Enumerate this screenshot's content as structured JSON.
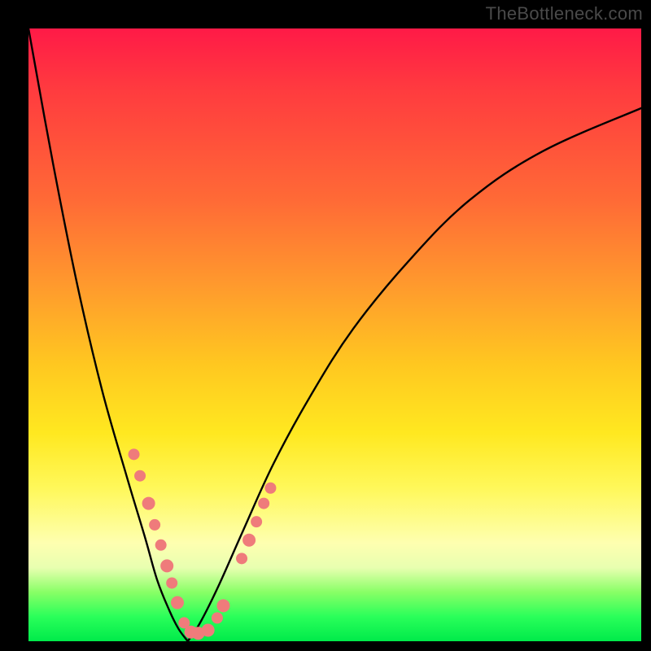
{
  "watermark": "TheBottleneck.com",
  "chart_data": {
    "type": "line",
    "title": "",
    "xlabel": "",
    "ylabel": "",
    "xlim": [
      0,
      100
    ],
    "ylim": [
      0,
      100
    ],
    "grid": false,
    "legend": false,
    "series": [
      {
        "name": "left-branch",
        "x": [
          0,
          4,
          8,
          12,
          16,
          19,
          21,
          23,
          24.5,
          26
        ],
        "y": [
          100,
          78,
          58,
          41,
          27,
          17,
          10,
          5,
          2,
          0
        ]
      },
      {
        "name": "right-branch",
        "x": [
          26,
          28,
          31,
          35,
          40,
          46,
          53,
          62,
          72,
          84,
          100
        ],
        "y": [
          0,
          3,
          9,
          18,
          29,
          40,
          51,
          62,
          72,
          80,
          87
        ]
      }
    ],
    "markers": [
      {
        "x": 17.2,
        "y": 30.5,
        "r": 7
      },
      {
        "x": 18.2,
        "y": 27.0,
        "r": 7
      },
      {
        "x": 19.6,
        "y": 22.5,
        "r": 8
      },
      {
        "x": 20.6,
        "y": 19.0,
        "r": 7
      },
      {
        "x": 21.6,
        "y": 15.7,
        "r": 7
      },
      {
        "x": 22.6,
        "y": 12.3,
        "r": 8
      },
      {
        "x": 23.4,
        "y": 9.5,
        "r": 7
      },
      {
        "x": 24.3,
        "y": 6.3,
        "r": 8
      },
      {
        "x": 25.4,
        "y": 3.0,
        "r": 7
      },
      {
        "x": 26.5,
        "y": 1.5,
        "r": 8
      },
      {
        "x": 27.7,
        "y": 1.3,
        "r": 8
      },
      {
        "x": 29.3,
        "y": 1.8,
        "r": 8
      },
      {
        "x": 30.8,
        "y": 3.8,
        "r": 7
      },
      {
        "x": 31.8,
        "y": 5.8,
        "r": 8
      },
      {
        "x": 34.8,
        "y": 13.5,
        "r": 7
      },
      {
        "x": 36.0,
        "y": 16.5,
        "r": 8
      },
      {
        "x": 37.2,
        "y": 19.5,
        "r": 7
      },
      {
        "x": 38.4,
        "y": 22.5,
        "r": 7
      },
      {
        "x": 39.5,
        "y": 25.0,
        "r": 7
      }
    ],
    "colors": {
      "gradient_top": "#ff1a47",
      "gradient_mid": "#ffd820",
      "gradient_bottom": "#00ea4a",
      "curve": "#000000",
      "marker": "#ef7b7b",
      "frame": "#000000"
    }
  }
}
